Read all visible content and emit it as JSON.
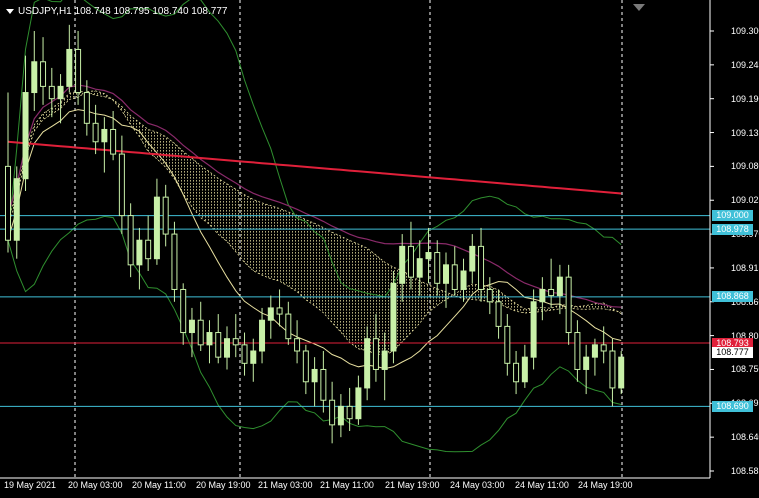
{
  "header": {
    "symbol": "USDJPY,H1",
    "ohlc": "108.748 108.795 108.740 108.777"
  },
  "colors": {
    "background": "#000000",
    "axis": "#ffffff",
    "grid": "#ffffff",
    "bull_candle": "#c8f0a8",
    "bear_candle": "#c8f0a8",
    "ma_red": "#e0203a",
    "ma_purple": "#8a2a6a",
    "bollinger": "#2f8f2f",
    "ma_yellow": "#e8e0a0",
    "cloud": "#e8e0a0",
    "hline_cyan": "#40c0d8",
    "hline_red": "#e0203a",
    "badge_cyan_bg": "#40c0d8",
    "badge_red_bg": "#e0203a"
  },
  "chart_data": {
    "type": "candlestick",
    "ylim": [
      108.585,
      109.33
    ],
    "yticks": [
      "109.300",
      "109.245",
      "109.190",
      "109.135",
      "109.080",
      "109.025",
      "108.970",
      "108.915",
      "108.860",
      "108.805",
      "108.750",
      "108.695",
      "108.640",
      "108.585"
    ],
    "xticks": [
      "19 May 2021",
      "20 May 03:00",
      "20 May 11:00",
      "20 May 19:00",
      "21 May 03:00",
      "21 May 11:00",
      "21 May 19:00",
      "24 May 03:00",
      "24 May 11:00",
      "24 May 19:00"
    ],
    "price_levels": [
      {
        "label": "109.000",
        "value": 109.0,
        "color": "cyan"
      },
      {
        "label": "108.978",
        "value": 108.978,
        "color": "cyan"
      },
      {
        "label": "108.868",
        "value": 108.868,
        "color": "cyan"
      },
      {
        "label": "108.793",
        "value": 108.793,
        "color": "red"
      },
      {
        "label": "108.777",
        "value": 108.777,
        "color": "white"
      },
      {
        "label": "108.690",
        "value": 108.69,
        "color": "cyan"
      }
    ],
    "candles": [
      [
        109.08,
        109.2,
        108.94,
        108.96
      ],
      [
        108.96,
        109.08,
        108.93,
        109.06
      ],
      [
        109.06,
        109.26,
        109.04,
        109.2
      ],
      [
        109.2,
        109.3,
        109.17,
        109.25
      ],
      [
        109.25,
        109.29,
        109.18,
        109.21
      ],
      [
        109.21,
        109.24,
        109.16,
        109.19
      ],
      [
        109.19,
        109.23,
        109.15,
        109.21
      ],
      [
        109.21,
        109.31,
        109.2,
        109.27
      ],
      [
        109.27,
        109.3,
        109.18,
        109.2
      ],
      [
        109.2,
        109.22,
        109.13,
        109.15
      ],
      [
        109.15,
        109.18,
        109.1,
        109.12
      ],
      [
        109.12,
        109.16,
        109.07,
        109.14
      ],
      [
        109.14,
        109.17,
        109.09,
        109.1
      ],
      [
        109.1,
        109.13,
        108.97,
        109.0
      ],
      [
        109.0,
        109.02,
        108.9,
        108.92
      ],
      [
        108.92,
        108.98,
        108.88,
        108.96
      ],
      [
        108.96,
        109.0,
        108.91,
        108.93
      ],
      [
        108.93,
        109.06,
        108.92,
        109.03
      ],
      [
        109.03,
        109.05,
        108.95,
        108.97
      ],
      [
        108.97,
        108.99,
        108.86,
        108.88
      ],
      [
        108.88,
        108.89,
        108.79,
        108.81
      ],
      [
        108.81,
        108.85,
        108.77,
        108.83
      ],
      [
        108.83,
        108.86,
        108.78,
        108.79
      ],
      [
        108.79,
        108.83,
        108.76,
        108.81
      ],
      [
        108.81,
        108.84,
        108.76,
        108.77
      ],
      [
        108.77,
        108.82,
        108.75,
        108.8
      ],
      [
        108.8,
        108.84,
        108.77,
        108.79
      ],
      [
        108.79,
        108.81,
        108.74,
        108.76
      ],
      [
        108.76,
        108.8,
        108.73,
        108.78
      ],
      [
        108.78,
        108.85,
        108.76,
        108.83
      ],
      [
        108.83,
        108.87,
        108.8,
        108.85
      ],
      [
        108.85,
        108.88,
        108.82,
        108.84
      ],
      [
        108.84,
        108.86,
        108.79,
        108.8
      ],
      [
        108.8,
        108.83,
        108.76,
        108.78
      ],
      [
        108.78,
        108.79,
        108.71,
        108.73
      ],
      [
        108.73,
        108.77,
        108.69,
        108.75
      ],
      [
        108.75,
        108.78,
        108.68,
        108.7
      ],
      [
        108.7,
        108.73,
        108.63,
        108.66
      ],
      [
        108.66,
        108.71,
        108.64,
        108.69
      ],
      [
        108.69,
        108.72,
        108.65,
        108.67
      ],
      [
        108.67,
        108.74,
        108.66,
        108.72
      ],
      [
        108.72,
        108.82,
        108.7,
        108.8
      ],
      [
        108.8,
        108.84,
        108.73,
        108.75
      ],
      [
        108.75,
        108.81,
        108.7,
        108.78
      ],
      [
        108.78,
        108.91,
        108.76,
        108.89
      ],
      [
        108.89,
        108.97,
        108.86,
        108.95
      ],
      [
        108.95,
        108.99,
        108.88,
        108.9
      ],
      [
        108.9,
        108.96,
        108.87,
        108.93
      ],
      [
        108.93,
        108.98,
        108.89,
        108.94
      ],
      [
        108.94,
        108.96,
        108.87,
        108.89
      ],
      [
        108.89,
        108.94,
        108.85,
        108.92
      ],
      [
        108.92,
        108.95,
        108.87,
        108.88
      ],
      [
        108.88,
        108.93,
        108.86,
        108.91
      ],
      [
        108.91,
        108.97,
        108.89,
        108.95
      ],
      [
        108.95,
        108.98,
        108.86,
        108.88
      ],
      [
        108.88,
        108.9,
        108.84,
        108.86
      ],
      [
        108.86,
        108.88,
        108.8,
        108.82
      ],
      [
        108.82,
        108.84,
        108.74,
        108.76
      ],
      [
        108.76,
        108.78,
        108.71,
        108.73
      ],
      [
        108.73,
        108.79,
        108.72,
        108.77
      ],
      [
        108.77,
        108.88,
        108.75,
        108.86
      ],
      [
        108.86,
        108.9,
        108.83,
        108.88
      ],
      [
        108.88,
        108.93,
        108.85,
        108.87
      ],
      [
        108.87,
        108.92,
        108.84,
        108.9
      ],
      [
        108.9,
        108.92,
        108.79,
        108.81
      ],
      [
        108.81,
        108.83,
        108.73,
        108.75
      ],
      [
        108.75,
        108.79,
        108.71,
        108.77
      ],
      [
        108.77,
        108.8,
        108.74,
        108.79
      ],
      [
        108.79,
        108.82,
        108.76,
        108.78
      ],
      [
        108.78,
        108.8,
        108.69,
        108.72
      ],
      [
        108.72,
        108.78,
        108.71,
        108.77
      ]
    ]
  }
}
